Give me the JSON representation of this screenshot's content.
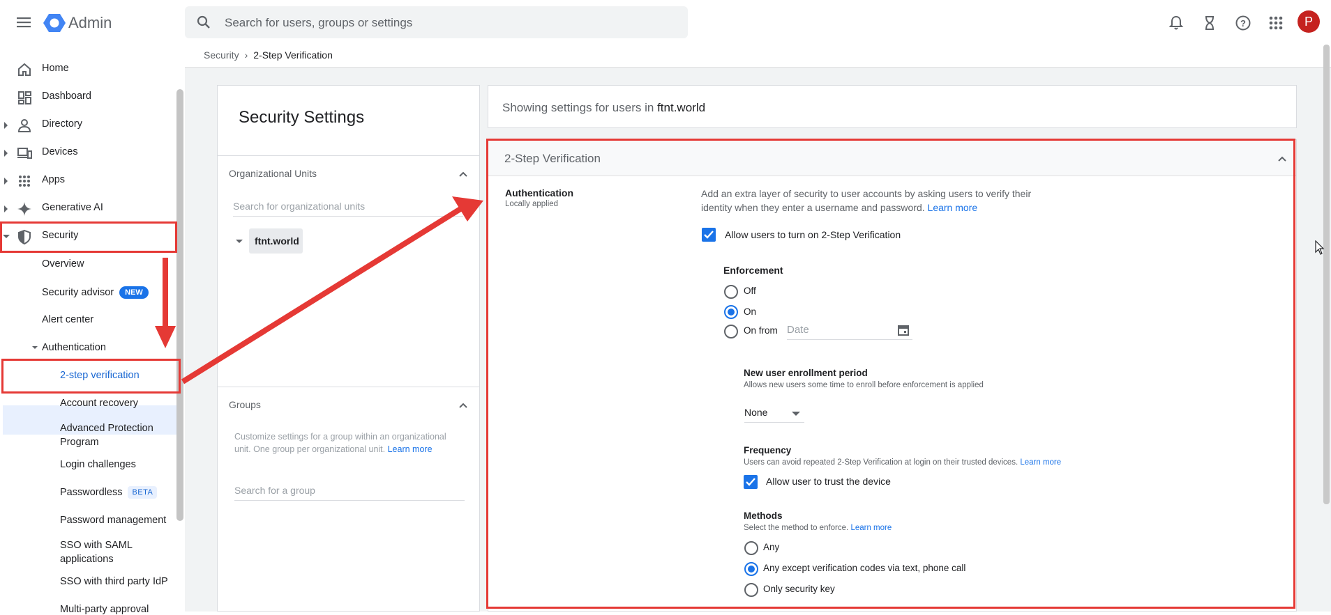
{
  "app": {
    "brand": "Admin",
    "avatar_letter": "P"
  },
  "search": {
    "placeholder": "Search for users, groups or settings"
  },
  "top_icons": [
    "bell-icon",
    "hourglass-icon",
    "help-icon",
    "apps-grid-icon"
  ],
  "sidebar": {
    "items": [
      {
        "label": "Home",
        "icon": "home-icon",
        "expandable": false
      },
      {
        "label": "Dashboard",
        "icon": "dashboard-icon",
        "expandable": false
      },
      {
        "label": "Directory",
        "icon": "person-icon",
        "expandable": true
      },
      {
        "label": "Devices",
        "icon": "devices-icon",
        "expandable": true
      },
      {
        "label": "Apps",
        "icon": "apps-icon",
        "expandable": true
      },
      {
        "label": "Generative AI",
        "icon": "sparkle-icon",
        "expandable": true
      },
      {
        "label": "Security",
        "icon": "shield-icon",
        "expandable": true,
        "expanded": true
      }
    ],
    "security_children": [
      "Overview",
      "Security advisor",
      "Alert center",
      "Authentication"
    ],
    "security_advisor_badge": "NEW",
    "authentication_children": [
      "2-step verification",
      "Account recovery",
      "Advanced Protection Program",
      "Login challenges",
      "Passwordless",
      "Password management",
      "SSO with SAML applications",
      "SSO with third party IdP",
      "Multi-party approval"
    ],
    "passwordless_badge": "BETA",
    "active": "2-step verification"
  },
  "breadcrumb": {
    "parent": "Security",
    "current": "2-Step Verification"
  },
  "left_panel": {
    "title": "Security Settings",
    "org_units": {
      "header": "Organizational Units",
      "search_placeholder": "Search for organizational units",
      "root": "ftnt.world"
    },
    "groups": {
      "header": "Groups",
      "description": "Customize settings for a group within an organizational unit. One group per organizational unit.",
      "learn_more": "Learn more",
      "search_placeholder": "Search for a group"
    }
  },
  "showing": {
    "prefix": "Showing settings for users in",
    "org": "ftnt.world"
  },
  "card": {
    "title": "2-Step Verification",
    "auth_title": "Authentication",
    "auth_subtitle": "Locally applied",
    "description": "Add an extra layer of security to user accounts by asking users to verify their identity when they enter a username and password.",
    "learn_more": "Learn more",
    "allow_2sv": {
      "label": "Allow users to turn on 2-Step Verification",
      "checked": true
    },
    "enforcement": {
      "title": "Enforcement",
      "options": [
        "Off",
        "On",
        "On from"
      ],
      "selected": "On",
      "date_placeholder": "Date"
    },
    "enrollment": {
      "title": "New user enrollment period",
      "description": "Allows new users some time to enroll before enforcement is applied",
      "value": "None"
    },
    "frequency": {
      "title": "Frequency",
      "description": "Users can avoid repeated 2-Step Verification at login on their trusted devices.",
      "learn_more": "Learn more",
      "trust_label": "Allow user to trust the device",
      "trust_checked": true
    },
    "methods": {
      "title": "Methods",
      "description": "Select the method to enforce.",
      "learn_more": "Learn more",
      "options": [
        "Any",
        "Any except verification codes via text, phone call",
        "Only security key"
      ],
      "selected": "Any except verification codes via text, phone call"
    }
  },
  "colors": {
    "accent": "#1a73e8",
    "annotation": "#e53935",
    "active_bg": "#e8f0fe",
    "avatar": "#c5221f"
  }
}
